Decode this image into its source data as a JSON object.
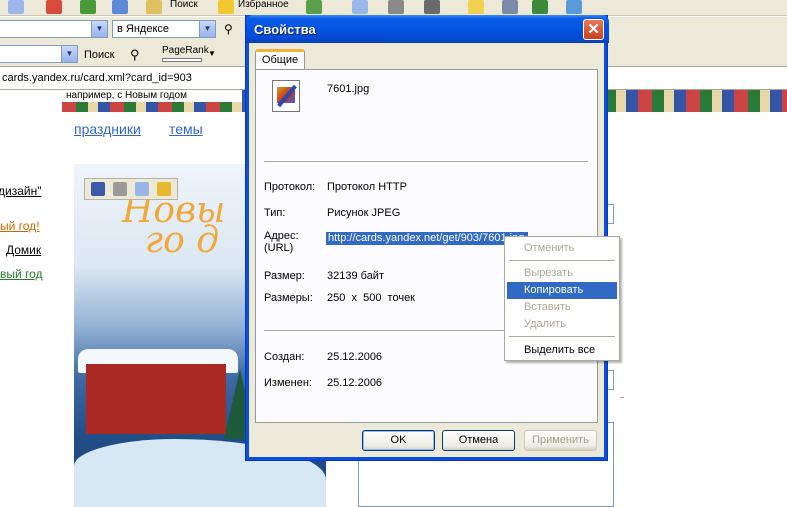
{
  "browser": {
    "toolbar_search": "Поиск",
    "toolbar_favorites": "Избранное",
    "search_scope": "в Яндексе",
    "search_label": "Поиск",
    "pagerank_label": "PageRank",
    "address": "cards.yandex.ru/card.xml?card_id=903",
    "banner_text": "например, с Новым годом",
    "nav_links": [
      "праздники",
      "темы"
    ],
    "side_links": [
      "дизайн\"",
      "ый год!",
      "Домик",
      "вый год"
    ]
  },
  "dialog": {
    "title": "Свойства",
    "tab": "Общие",
    "file_name": "7601.jpg",
    "labels": {
      "protocol": "Протокол:",
      "type": "Тип:",
      "address": "Адрес:",
      "address_sub": "(URL)",
      "size": "Размер:",
      "dimensions": "Размеры:",
      "created": "Создан:",
      "modified": "Изменен:"
    },
    "values": {
      "protocol": "Протокол HTTP",
      "type": "Рисунок JPEG",
      "address": "http://cards.yandex.net/get/903/7601.jpg",
      "size": "32139 байт",
      "dimensions": "250  x  500  точек",
      "created": "25.12.2006",
      "modified": "25.12.2006"
    },
    "buttons": {
      "ok": "OK",
      "cancel": "Отмена",
      "apply": "Применить"
    }
  },
  "context_menu": {
    "items": [
      {
        "label": "Отменить",
        "enabled": false
      },
      {
        "label": "Вырезать",
        "enabled": false
      },
      {
        "label": "Копировать",
        "enabled": true,
        "highlighted": true
      },
      {
        "label": "Вставить",
        "enabled": false
      },
      {
        "label": "Удалить",
        "enabled": false
      },
      {
        "label": "Выделить все",
        "enabled": true
      }
    ]
  },
  "colors": {
    "titlebar": "#0453e3",
    "selection": "#316ac5",
    "link": "#3366cc"
  }
}
